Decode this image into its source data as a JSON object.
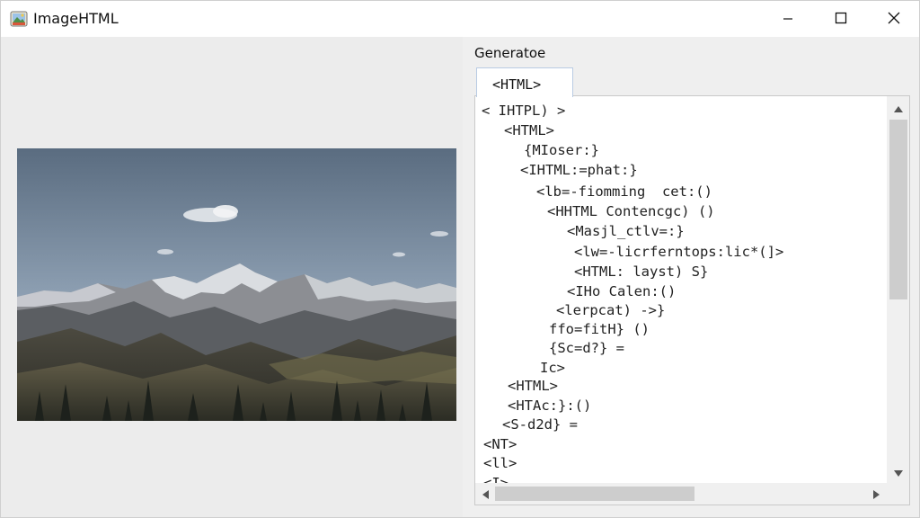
{
  "window": {
    "title": "ImageHTML",
    "icon": "app-picture-icon",
    "controls": [
      "minimize-icon",
      "maximize-icon",
      "close-icon"
    ]
  },
  "left_pane": {
    "image": "mountain-landscape-photo"
  },
  "right_pane": {
    "label": "Generatoe",
    "tab_label": "<HTML>",
    "code_lines": [
      "< IHTPL) >",
      "<HTML>",
      "{MIoser:}",
      "<IHTML:=phat:}",
      "<lb=-fiomming  cet:()",
      "<HHTML Contencgc) ()",
      "<Masjl_ctlv=:}",
      "<lw=-licrferntops:lic*(]>",
      "<HTML: layst) S}",
      "<IHo Calen:()",
      "<lerpcat) ->}",
      "ffo=fitH} ()",
      "{Sc=d?} =",
      "Ic>",
      "<HTML>",
      "<HTAc:}:()",
      "<S-d2d} =",
      "<NT>",
      "<ll>",
      "<I>"
    ]
  },
  "colors": {
    "titlebar_bg": "#ffffff",
    "window_bg": "#efefef",
    "tab_border": "#b9cbe3",
    "scrollbar_thumb": "#cdcdcd",
    "code_tag": "#7b1e2c"
  }
}
